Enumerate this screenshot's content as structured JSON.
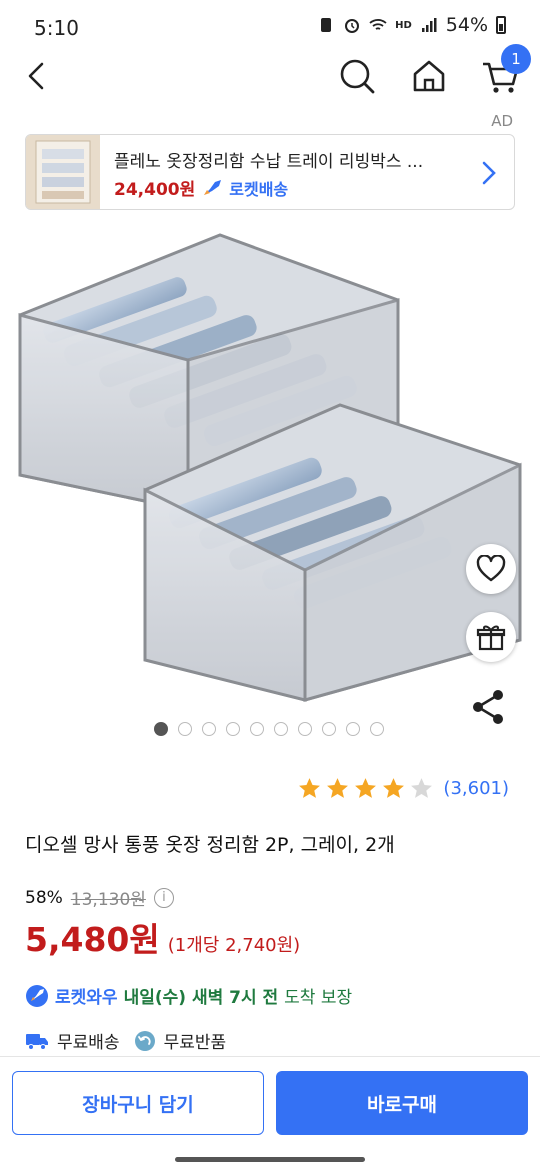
{
  "status": {
    "time": "5:10",
    "battery": "54%",
    "network_badge": "HD"
  },
  "topbar": {
    "cart_count": "1"
  },
  "ad": {
    "label": "AD",
    "title": "플레노 옷장정리함 수납 트레이 리빙박스 ...",
    "price": "24,400원",
    "rocket": "로켓배송"
  },
  "gallery": {
    "total_images": 10,
    "active_index": 0
  },
  "rating": {
    "stars": 4,
    "max_stars": 5,
    "review_count": "(3,601)"
  },
  "product": {
    "title": "디오셀 망사 통풍 옷장 정리함 2P, 그레이, 2개",
    "discount": "58%",
    "original_price": "13,130원",
    "sale_price": "5,480원",
    "unit_price": "(1개당 2,740원)"
  },
  "delivery": {
    "badge": "로켓와우",
    "arrival": "내일(수) 새벽 7시 전",
    "guarantee": "도착 보장"
  },
  "benefits": {
    "free_shipping": "무료배송",
    "free_return": "무료반품"
  },
  "actions": {
    "add_to_cart": "장바구니 담기",
    "buy_now": "바로구매"
  },
  "colors": {
    "accent": "#3471f4",
    "price_red": "#c21c1c",
    "delivery_green": "#1f7a3f",
    "star": "#f5a623"
  }
}
